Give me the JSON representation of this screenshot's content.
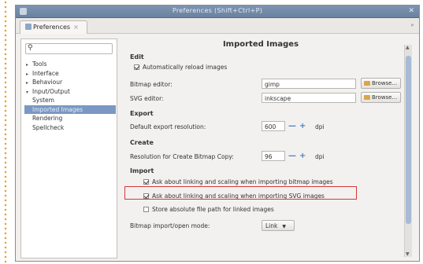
{
  "window": {
    "title": "Preferences (Shift+Ctrl+P)",
    "close_glyph": "✕"
  },
  "tab": {
    "label": "Preferences",
    "close_glyph": "×"
  },
  "search": {
    "icon_glyph": "⚲",
    "value": ""
  },
  "nav": {
    "items": [
      {
        "label": "Tools",
        "twisty": "▸"
      },
      {
        "label": "Interface",
        "twisty": "▸"
      },
      {
        "label": "Behaviour",
        "twisty": "▸"
      },
      {
        "label": "Input/Output",
        "twisty": "▾"
      },
      {
        "label": "System"
      },
      {
        "label": "Imported Images"
      },
      {
        "label": "Rendering"
      },
      {
        "label": "Spellcheck"
      }
    ]
  },
  "panel": {
    "header": "Imported Images",
    "edit": {
      "heading": "Edit",
      "auto_reload_label": "Automatically reload images",
      "auto_reload_checked": true,
      "bitmap_editor_label": "Bitmap editor:",
      "bitmap_editor_value": "gimp",
      "svg_editor_label": "SVG editor:",
      "svg_editor_value": "inkscape",
      "browse_label": "Browse..."
    },
    "export": {
      "heading": "Export",
      "resolution_label": "Default export resolution:",
      "resolution_value": "600",
      "unit": "dpi"
    },
    "create": {
      "heading": "Create",
      "resolution_label": "Resolution for Create Bitmap Copy:",
      "resolution_value": "96",
      "unit": "dpi"
    },
    "import": {
      "heading": "Import",
      "ask_bitmap_label": "Ask about linking and scaling when importing bitmap images",
      "ask_bitmap_checked": true,
      "ask_svg_label": "Ask about linking and scaling when importing SVG images",
      "ask_svg_checked": true,
      "store_absolute_label": "Store absolute file path for linked images",
      "store_absolute_checked": false,
      "mode_label": "Bitmap import/open mode:",
      "mode_value": "Link"
    },
    "spin_minus": "—",
    "spin_plus": "+"
  },
  "colors": {
    "titlebar": "#6b819f",
    "selection": "#7a98c3",
    "highlight": "#d5383a",
    "accent_dots": "#e8a13a"
  }
}
